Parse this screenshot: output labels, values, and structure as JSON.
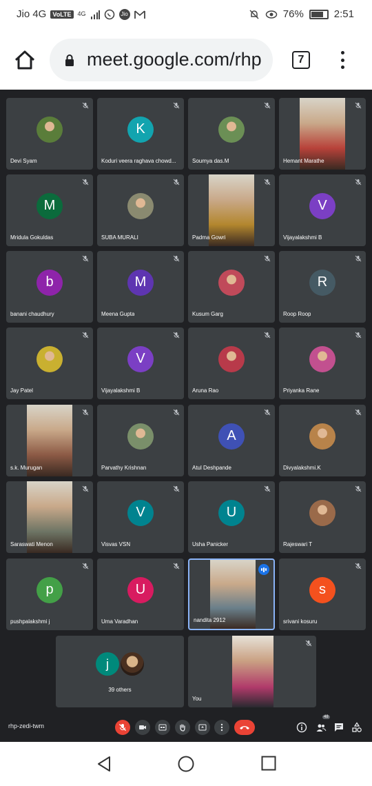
{
  "status_bar": {
    "carrier": "Jio 4G",
    "volte": "VoLTE",
    "network": "4G",
    "battery": "76%",
    "battery_level": 0.76,
    "time": "2:51"
  },
  "browser": {
    "url": "meet.google.com/rhp",
    "tab_count": "7"
  },
  "tiles": [
    {
      "name": "Devi Syam",
      "kind": "photo",
      "color": "#5a7d3a",
      "muted": true
    },
    {
      "name": "Koduri veera raghava chowd...",
      "kind": "letter",
      "letter": "K",
      "color": "#12a4af",
      "muted": true
    },
    {
      "name": "Soumya das.M",
      "kind": "photo",
      "color": "#6b8f55",
      "muted": true
    },
    {
      "name": "Hemant Marathe",
      "kind": "video",
      "color": "#b8423a",
      "muted": true
    },
    {
      "name": "Mridula Gokuldas",
      "kind": "letter",
      "letter": "M",
      "color": "#0b6b3c",
      "muted": true
    },
    {
      "name": "SUBA MURALI",
      "kind": "photo",
      "color": "#8a8a70",
      "muted": true
    },
    {
      "name": "Padma Gowri",
      "kind": "video",
      "color": "#b3872e",
      "muted": true
    },
    {
      "name": "Vijayalakshmi B",
      "kind": "letter",
      "letter": "V",
      "color": "#7b3fc4",
      "muted": true
    },
    {
      "name": "banani chaudhury",
      "kind": "letter",
      "letter": "b",
      "color": "#8e24aa",
      "muted": true
    },
    {
      "name": "Meena Gupta",
      "kind": "letter",
      "letter": "M",
      "color": "#5e35b1",
      "muted": true
    },
    {
      "name": "Kusum Garg",
      "kind": "photo",
      "color": "#c04a5a",
      "muted": true
    },
    {
      "name": "Roop Roop",
      "kind": "letter",
      "letter": "R",
      "color": "#455a64",
      "muted": true
    },
    {
      "name": "Jay Patel",
      "kind": "photo",
      "color": "#c9b030",
      "muted": true
    },
    {
      "name": "Vijayalakshmi B",
      "kind": "letter",
      "letter": "V",
      "color": "#7b3fc4",
      "muted": true
    },
    {
      "name": "Aruna Rao",
      "kind": "photo",
      "color": "#b83a4a",
      "muted": true
    },
    {
      "name": "Priyanka Rane",
      "kind": "photo",
      "color": "#c2508f",
      "muted": true
    },
    {
      "name": "s.k. Murugan",
      "kind": "video",
      "color": "#8c5a45",
      "muted": true
    },
    {
      "name": "Parvathy Krishnan",
      "kind": "photo",
      "color": "#7a8f6a",
      "muted": true
    },
    {
      "name": "Atul Deshpande",
      "kind": "letter",
      "letter": "A",
      "color": "#3f51b5",
      "muted": true
    },
    {
      "name": "Divyalakshmi.K",
      "kind": "photo",
      "color": "#b8834a",
      "muted": true
    },
    {
      "name": "Saraswati Menon",
      "kind": "video",
      "color": "#6e7565",
      "muted": true
    },
    {
      "name": "Visvas VSN",
      "kind": "letter",
      "letter": "V",
      "color": "#00838f",
      "muted": true
    },
    {
      "name": "Usha Panicker",
      "kind": "letter",
      "letter": "U",
      "color": "#00838f",
      "muted": true
    },
    {
      "name": "Rajeswari T",
      "kind": "photo",
      "color": "#9a6a4a",
      "muted": true
    },
    {
      "name": "pushpalakshmi j",
      "kind": "letter",
      "letter": "p",
      "color": "#43a047",
      "muted": true
    },
    {
      "name": "Uma Varadhan",
      "kind": "letter",
      "letter": "U",
      "color": "#d81b60",
      "muted": true
    },
    {
      "name": "nandita 2912",
      "kind": "video",
      "color": "#6a7f8a",
      "muted": false,
      "speaking": true
    },
    {
      "name": "srivani kosuru",
      "kind": "letter",
      "letter": "s",
      "color": "#f4511e",
      "muted": true
    }
  ],
  "others_tile": {
    "label": "39 others",
    "letter": "j",
    "color": "#00897b"
  },
  "self_tile": {
    "name": "You",
    "color": "#b03a6a"
  },
  "meeting_code": "rhp-zedi-twm",
  "participant_count": "48"
}
